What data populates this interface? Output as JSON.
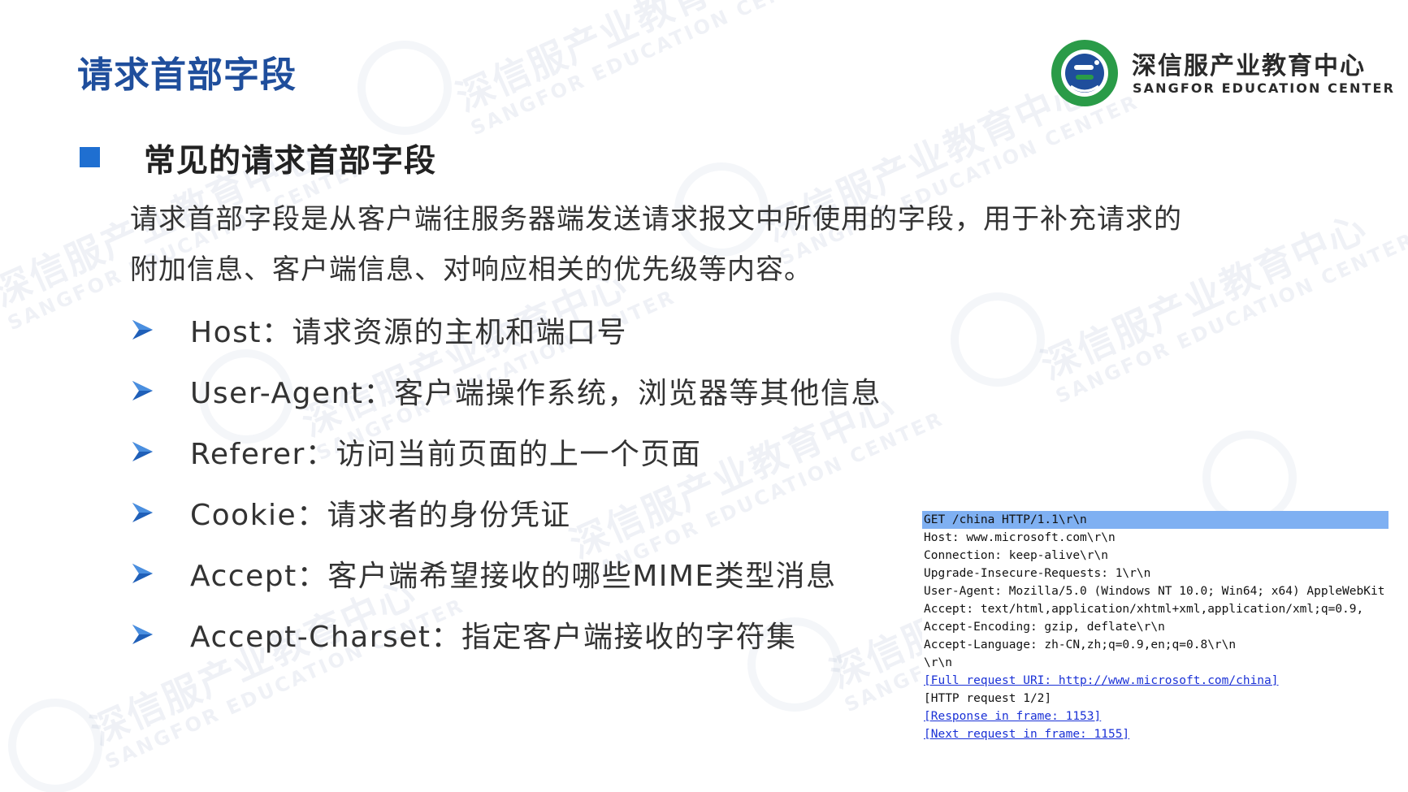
{
  "title": "请求首部字段",
  "logo": {
    "cn": "深信服产业教育中心",
    "en": "SANGFOR EDUCATION CENTER",
    "badge_ring_text": "SANGFOR EDUCATION CENTER",
    "badge_bottom_text": "深信服产业教育中心",
    "colors": {
      "ring": "#2a9b48",
      "inner": "#1f4e9c"
    }
  },
  "watermark": {
    "cn": "深信服产业教育中心",
    "en": "SANGFOR EDUCATION CENTER"
  },
  "section": {
    "heading": "常见的请求首部字段",
    "bullet_color": "#1f6fd1"
  },
  "intro": {
    "line1": "请求首部字段是从客户端往服务器端发送请求报文中所使用的字段，用于补充请求的",
    "line2": "附加信息、客户端信息、对响应相关的优先级等内容。"
  },
  "fields": [
    {
      "text": "Host：请求资源的主机和端口号",
      "icon": "arrow-bullet-icon"
    },
    {
      "text": "User-Agent：客户端操作系统，浏览器等其他信息",
      "icon": "arrow-bullet-icon"
    },
    {
      "text": "Referer：访问当前页面的上一个页面",
      "icon": "arrow-bullet-icon"
    },
    {
      "text": "Cookie：请求者的身份凭证",
      "icon": "arrow-bullet-icon"
    },
    {
      "text": "Accept：客户端希望接收的哪些MIME类型消息",
      "icon": "arrow-bullet-icon"
    },
    {
      "text": "Accept-Charset：指定客户端接收的字符集",
      "icon": "arrow-bullet-icon"
    }
  ],
  "http_request": {
    "selected_line_color": "#7fb0f2",
    "link_color": "#1a31d6",
    "lines": [
      "GET /china HTTP/1.1\\r\\n",
      "Host: www.microsoft.com\\r\\n",
      "Connection: keep-alive\\r\\n",
      "Upgrade-Insecure-Requests: 1\\r\\n",
      "User-Agent: Mozilla/5.0 (Windows NT 10.0; Win64; x64) AppleWebKit",
      "Accept: text/html,application/xhtml+xml,application/xml;q=0.9,",
      "Accept-Encoding: gzip, deflate\\r\\n",
      "Accept-Language: zh-CN,zh;q=0.9,en;q=0.8\\r\\n",
      "\\r\\n",
      "[Full request URI: http://www.microsoft.com/china]",
      "[HTTP request 1/2]",
      "[Response in frame: 1153]",
      "[Next request in frame: 1155]"
    ]
  }
}
